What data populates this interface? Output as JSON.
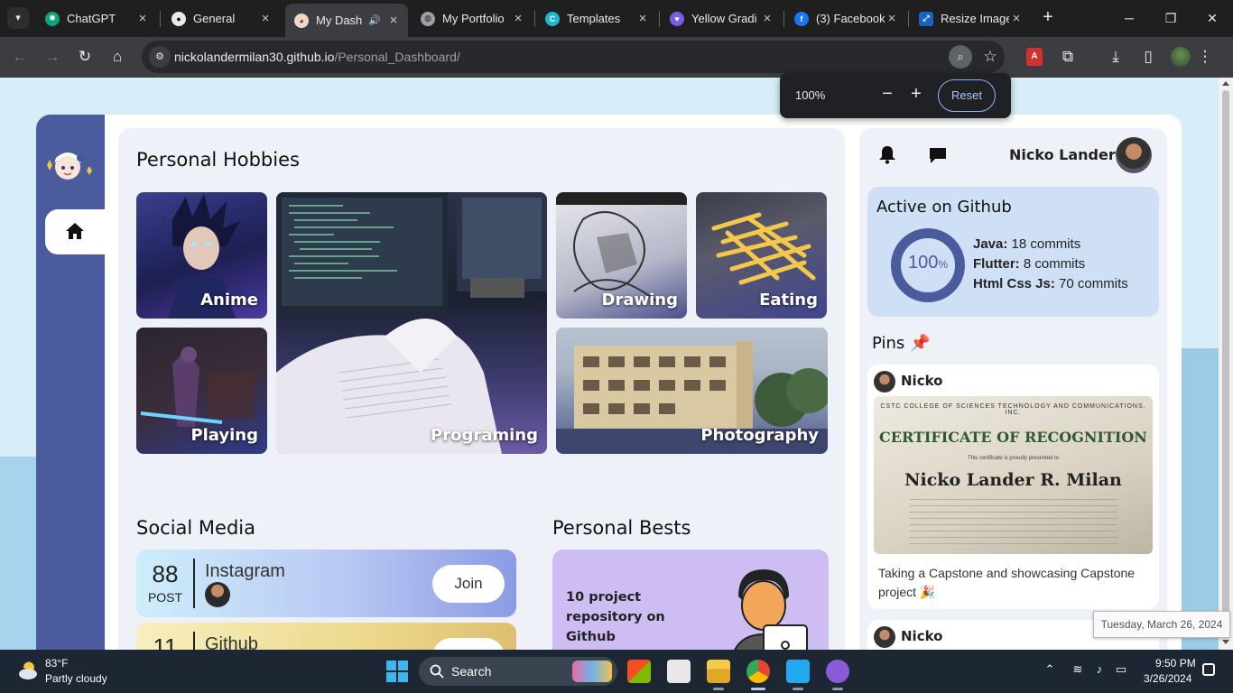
{
  "browser": {
    "tabs": [
      {
        "label": "ChatGPT",
        "icon": "chatgpt-icon"
      },
      {
        "label": "General",
        "icon": "github-icon"
      },
      {
        "label": "My Dash",
        "icon": "anime-favicon"
      },
      {
        "label": "My Portfolio",
        "icon": "globe-icon"
      },
      {
        "label": "Templates",
        "icon": "canva-icon"
      },
      {
        "label": "Yellow Gradi",
        "icon": "heart-icon"
      },
      {
        "label": "(3) Facebook",
        "icon": "facebook-icon"
      },
      {
        "label": "Resize Image",
        "icon": "resize-icon"
      }
    ],
    "active_tab": 2,
    "url_host": "nickolandermilan30.github.io",
    "url_path": "/Personal_Dashboard/",
    "zoom_popup": {
      "percent": "100%",
      "minus": "−",
      "plus": "+",
      "reset_label": "Reset"
    }
  },
  "dashboard": {
    "hobbies_title": "Personal Hobbies",
    "hobbies": [
      {
        "label": "Anime"
      },
      {
        "label": "Programing"
      },
      {
        "label": "Drawing"
      },
      {
        "label": "Eating"
      },
      {
        "label": "Playing"
      },
      {
        "label": "Photography"
      }
    ],
    "social_title": "Social Media",
    "social": [
      {
        "count": "88",
        "unit": "POST",
        "name": "Instagram",
        "action": "Join"
      },
      {
        "count": "11",
        "unit": "",
        "name": "Github",
        "action": "Join"
      }
    ],
    "bests_title": "Personal Bests",
    "bests_text": "10 project repository on Github"
  },
  "sidebar_right": {
    "user_name": "Nicko Lander",
    "github_title": "Active on Github",
    "github_percent": "100",
    "github_percent_sign": "%",
    "stats": [
      {
        "lang": "Java:",
        "value": "18 commits"
      },
      {
        "lang": "Flutter:",
        "value": "8 commits"
      },
      {
        "lang": "Html Css Js:",
        "value": "70 commits"
      }
    ],
    "pins_title": "Pins 📌",
    "pins": [
      {
        "user": "Nicko",
        "image_title": "CERTIFICATE OF RECOGNITION",
        "image_header": "CSTC COLLEGE OF SCIENCES TECHNOLOGY AND COMMUNICATIONS, INC.",
        "image_subtitle": "This certificate is proudly presented to",
        "image_name": "Nicko Lander R. Milan",
        "caption": "Taking a Capstone and showcasing Capstone project 🎉"
      },
      {
        "user": "Nicko"
      }
    ]
  },
  "tooltip": "Tuesday, March 26, 2024",
  "taskbar": {
    "weather_temp": "83°F",
    "weather_desc": "Partly cloudy",
    "search_label": "Search",
    "time": "9:50 PM",
    "date": "3/26/2024"
  },
  "colors": {
    "sidebar": "#4a5c9e",
    "panel": "#eef1f7",
    "github_card": "#cfe0f6",
    "bests_card": "#cdbdf2",
    "page_bg": "#d7eef8"
  }
}
